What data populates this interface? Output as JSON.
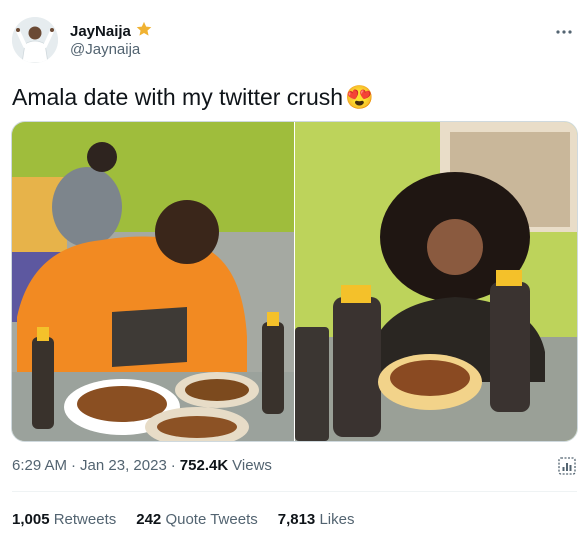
{
  "user": {
    "name": "JayNaija",
    "handle": "@Jaynaija"
  },
  "tweet": {
    "text": "Amala date with my twitter crush",
    "emoji": "😍"
  },
  "meta": {
    "time": "6:29 AM",
    "dot1": "·",
    "date": "Jan 23, 2023",
    "dot2": "·",
    "views_count": "752.4K",
    "views_label": "Views"
  },
  "stats": {
    "retweets": {
      "count": "1,005",
      "label": "Retweets"
    },
    "quote_tweets": {
      "count": "242",
      "label": "Quote Tweets"
    },
    "likes": {
      "count": "7,813",
      "label": "Likes"
    }
  },
  "icons": {
    "verified": "star-badge-icon",
    "more": "more-icon",
    "analytics": "analytics-icon"
  },
  "colors": {
    "text": "#0f1419",
    "secondary": "#536471",
    "badge": "#f0b232",
    "divider": "#eff3f4"
  }
}
